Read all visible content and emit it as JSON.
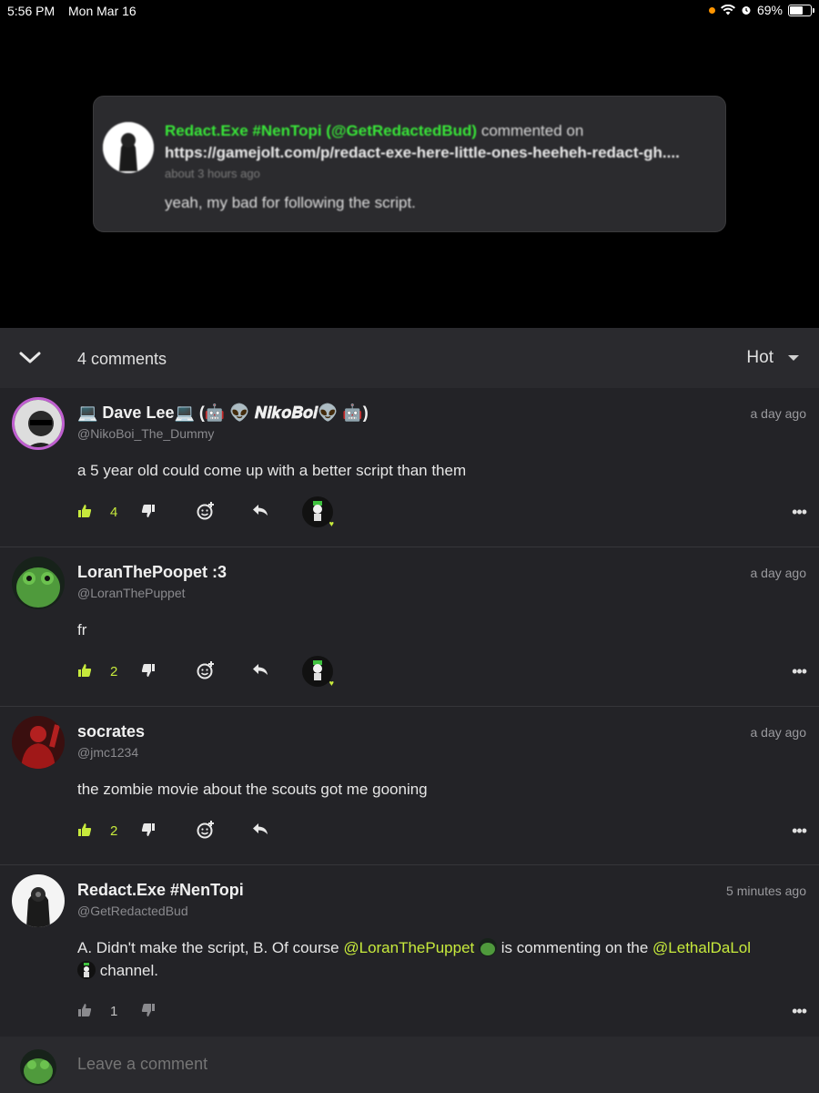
{
  "status_bar": {
    "time": "5:56 PM",
    "date": "Mon Mar 16",
    "battery": "69%",
    "battery_level": 0.69
  },
  "notification": {
    "author": "Redact.Exe #NenTopi (@GetRedactedBud)",
    "action": "commented on",
    "url": "https://gamejolt.com/p/redact-exe-here-little-ones-heeheh-redact-gh....",
    "time": "about 3 hours ago",
    "text": "yeah, my bad for following the script."
  },
  "sheet": {
    "count_label": "4 comments",
    "sort_label": "Hot",
    "compose_placeholder": "Leave a comment"
  },
  "comments": [
    {
      "name": "💻 Dave Lee💻  (🤖 👽 𝑵𝒊𝒌𝒐𝑩𝒐𝒊👽 🤖)",
      "handle": "@NikoBoi_The_Dummy",
      "time": "a day ago",
      "body": "a 5 year old could come up with a better script than them",
      "likes": "4"
    },
    {
      "name": "LoranThePoopet :3",
      "handle": "@LoranThePuppet",
      "time": "a day ago",
      "body": "fr",
      "likes": "2"
    },
    {
      "name": "socrates",
      "handle": "@jmc1234",
      "time": "a day ago",
      "body": "the zombie movie about the scouts got me gooning",
      "likes": "2"
    },
    {
      "name": "Redact.Exe #NenTopi",
      "handle": "@GetRedactedBud",
      "time": "5 minutes ago",
      "body_parts": {
        "a": "A. Didn't make the script, B. Of course ",
        "m1": "@LoranThePuppet",
        "b": " is commenting on the ",
        "m2": "@LethalDaLol",
        "c": " channel."
      },
      "likes": "1"
    }
  ],
  "colors": {
    "accent": "#c7ea3c",
    "notif_author": "#39e639",
    "background": "#232327"
  },
  "icons": [
    "thumbs-up-icon",
    "thumbs-down-icon",
    "add-reaction-icon",
    "reply-icon",
    "more-icon",
    "chevron-down-icon"
  ]
}
